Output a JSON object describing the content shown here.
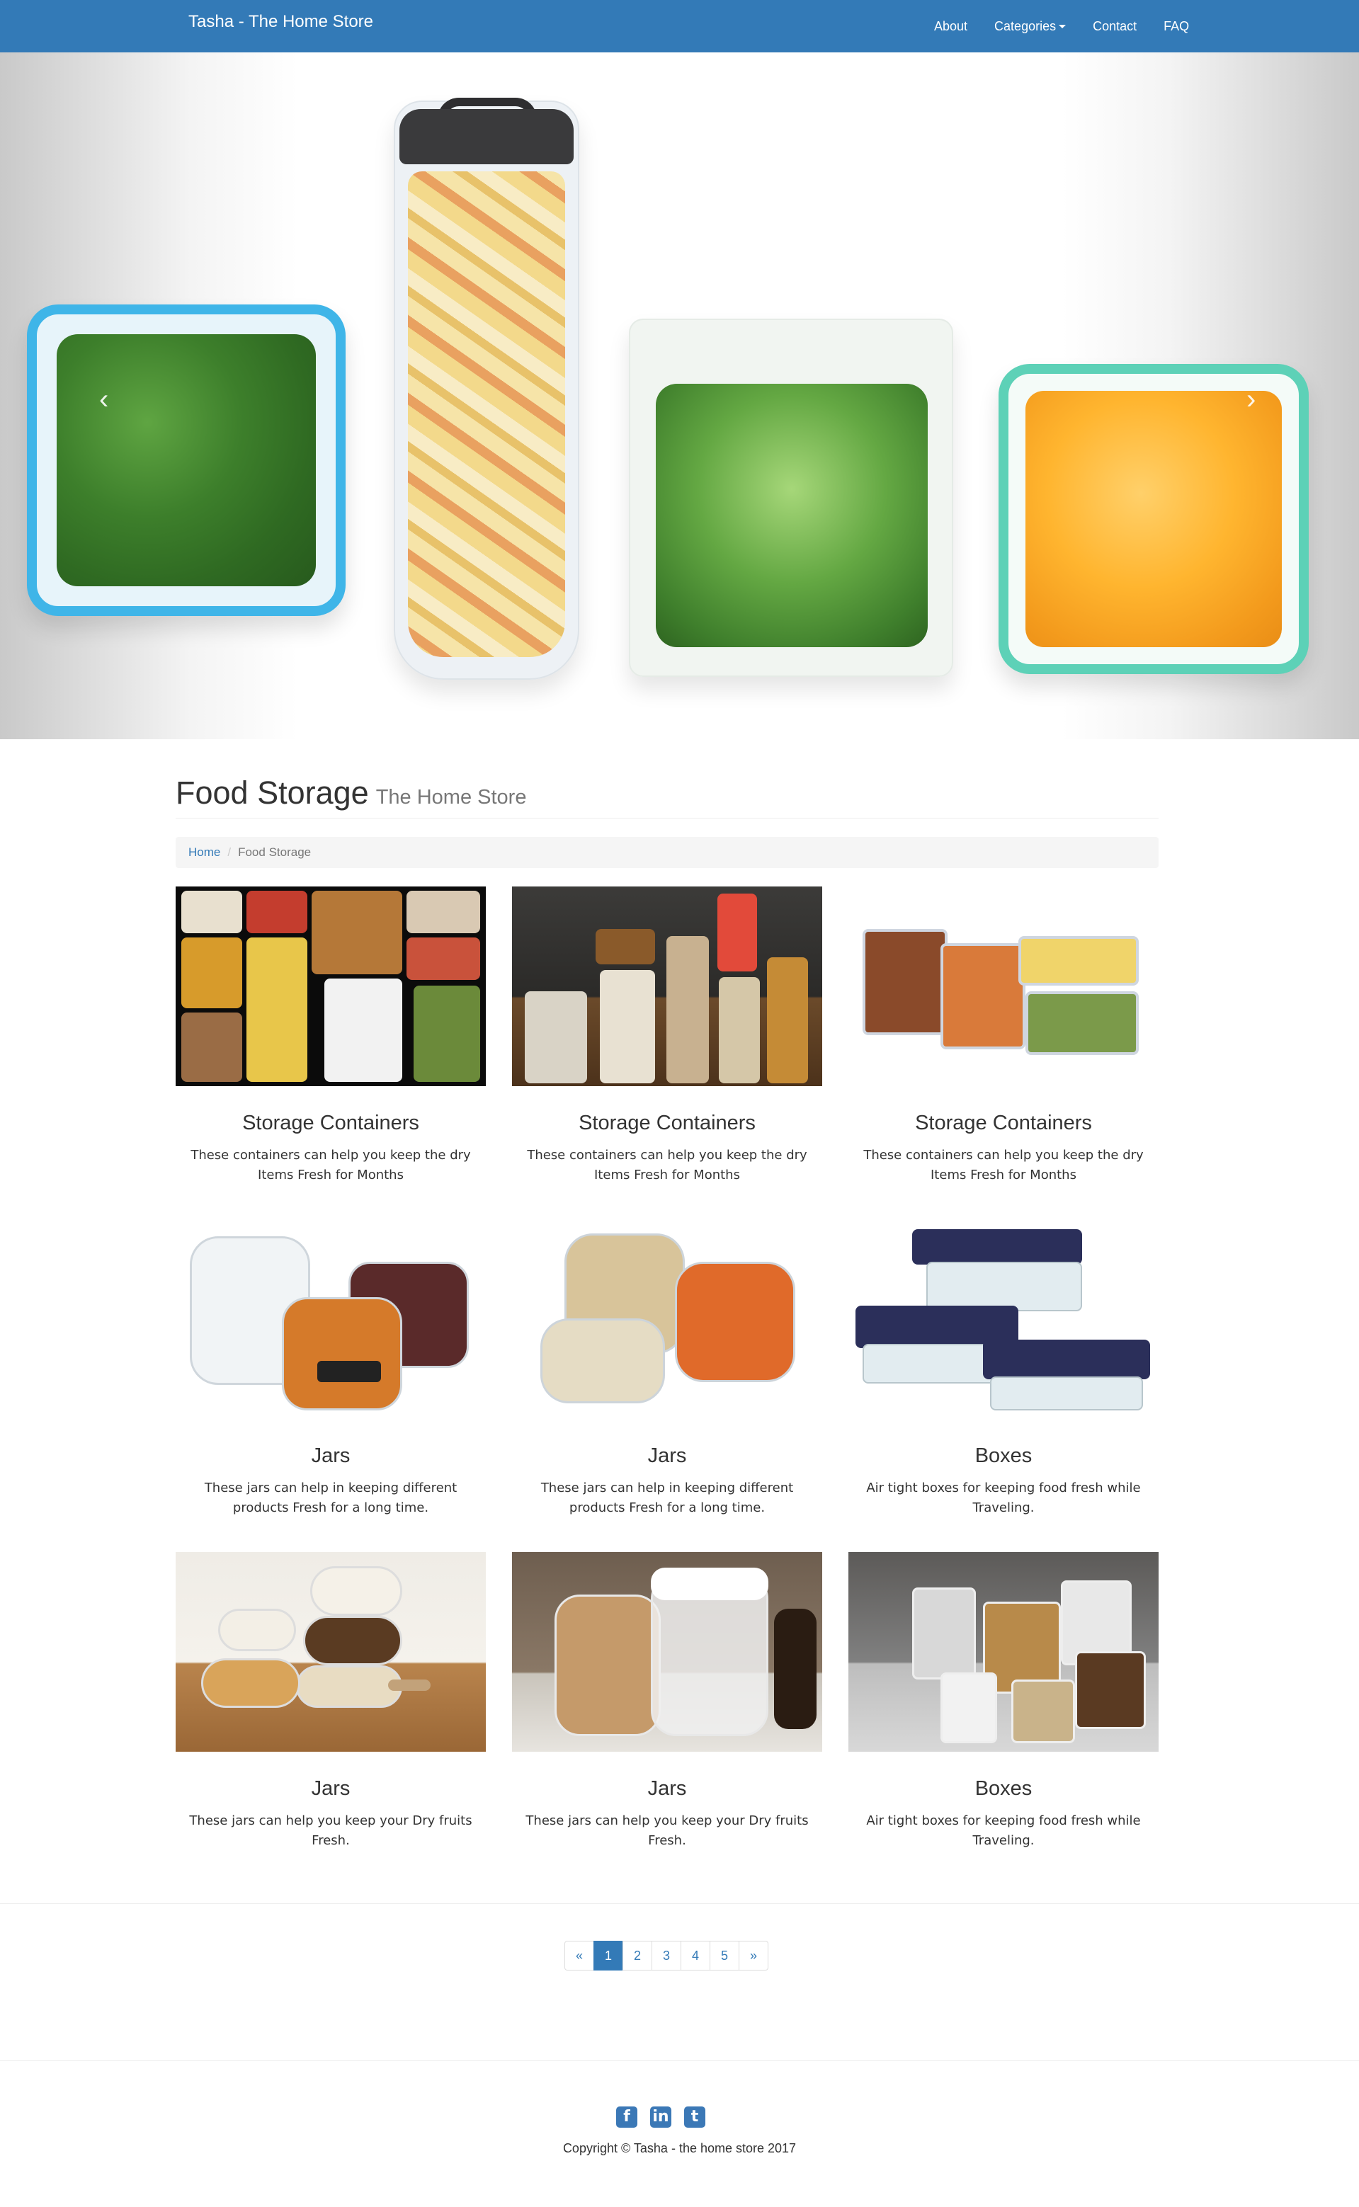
{
  "navbar": {
    "brand": "Tasha - The Home Store",
    "links": {
      "about": "About",
      "categories": "Categories",
      "contact": "Contact",
      "faq": "FAQ"
    }
  },
  "carousel": {
    "prev": "‹",
    "next": "›"
  },
  "header": {
    "title": "Food Storage",
    "subtitle": "The Home Store"
  },
  "breadcrumb": {
    "home": "Home",
    "current": "Food Storage"
  },
  "products": [
    {
      "title": "Storage Containers",
      "desc": "These containers can help you keep the dry Items Fresh for Months"
    },
    {
      "title": "Storage Containers",
      "desc": "These containers can help you keep the dry Items Fresh for Months"
    },
    {
      "title": "Storage Containers",
      "desc": "These containers can help you keep the dry Items Fresh for Months"
    },
    {
      "title": "Jars",
      "desc": "These jars can help in keeping different products Fresh for a long time."
    },
    {
      "title": "Jars",
      "desc": "These jars can help in keeping different products Fresh for a long time."
    },
    {
      "title": "Boxes",
      "desc": "Air tight boxes for keeping food fresh while Traveling."
    },
    {
      "title": "Jars",
      "desc": "These jars can help you keep your Dry fruits Fresh."
    },
    {
      "title": "Jars",
      "desc": "These jars can help you keep your Dry fruits Fresh."
    },
    {
      "title": "Boxes",
      "desc": "Air tight boxes for keeping food fresh while Traveling."
    }
  ],
  "pagination": {
    "prev": "«",
    "pages": [
      "1",
      "2",
      "3",
      "4",
      "5"
    ],
    "next": "»",
    "active": "1"
  },
  "footer": {
    "social": {
      "facebook": "f",
      "linkedin": "in",
      "twitter": "t"
    },
    "copyright": "Copyright © Tasha - the home store 2017"
  },
  "colors": {
    "primary": "#337ab7",
    "text": "#333333",
    "muted": "#777777"
  }
}
